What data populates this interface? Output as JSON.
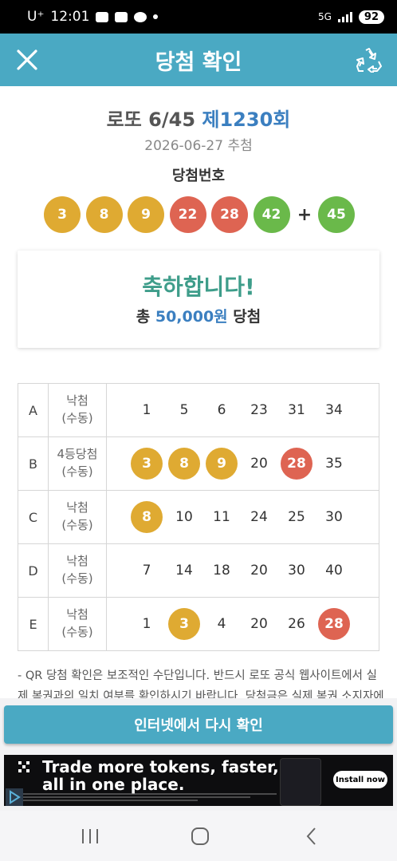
{
  "status_bar": {
    "carrier": "U⁺",
    "time": "12:01",
    "network": "5G",
    "battery": "92"
  },
  "app_bar": {
    "title": "당첨 확인",
    "close_icon": "close-icon",
    "share_icon": "recycle-icon"
  },
  "draw": {
    "game_name": "로또 6/45",
    "round": "제1230회",
    "date": "2026-06-27 추첨",
    "winning_label": "당첨번호",
    "numbers": [
      "3",
      "8",
      "9",
      "22",
      "28",
      "42"
    ],
    "plus": "+",
    "bonus": "45"
  },
  "result": {
    "congrats": "축하합니다!",
    "total_prefix": "총",
    "amount": "50,000원",
    "total_suffix": "당첨"
  },
  "games": [
    {
      "id": "A",
      "status": "낙첨",
      "mode": "(수동)",
      "numbers": [
        "1",
        "5",
        "6",
        "23",
        "31",
        "34"
      ]
    },
    {
      "id": "B",
      "status": "4등당첨",
      "mode": "(수동)",
      "numbers": [
        "3",
        "8",
        "9",
        "20",
        "28",
        "35"
      ]
    },
    {
      "id": "C",
      "status": "낙첨",
      "mode": "(수동)",
      "numbers": [
        "8",
        "10",
        "11",
        "24",
        "25",
        "30"
      ]
    },
    {
      "id": "D",
      "status": "낙첨",
      "mode": "(수동)",
      "numbers": [
        "7",
        "14",
        "18",
        "20",
        "30",
        "40"
      ]
    },
    {
      "id": "E",
      "status": "낙첨",
      "mode": "(수동)",
      "numbers": [
        "1",
        "3",
        "4",
        "20",
        "26",
        "28"
      ]
    }
  ],
  "notice": "- QR 당첨 확인은 보조적인 수단입니다. 반드시 로또 공식 웹사이트에서 실제 복권과의 일치 여부를 확인하시기 바랍니다. 당첨금은 실제 복권 소지자에게",
  "recheck_button": "인터넷에서 다시 확인",
  "ad": {
    "headline_1": "Trade more tokens, faster,",
    "headline_2": "all in one place.",
    "install": "Install now"
  },
  "colors": {
    "primary": "#4aa9c3",
    "ball_yellow": "#dfaa32",
    "ball_red": "#de6452",
    "ball_green": "#6ab94a",
    "congrats": "#3e9d8a",
    "round_blue": "#3b7fc0"
  }
}
